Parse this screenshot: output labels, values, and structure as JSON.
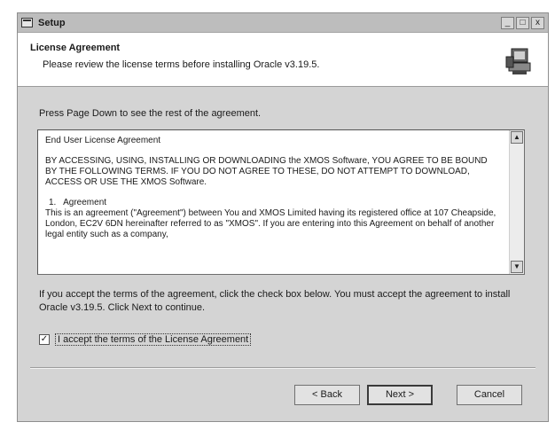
{
  "window": {
    "title": "Setup",
    "controls": {
      "minimize": "_",
      "maximize": "□",
      "close": "x"
    }
  },
  "header": {
    "title": "License Agreement",
    "subtitle": "Please review the license terms before installing Oracle v3.19.5."
  },
  "instructions": "Press Page Down to see the rest of the agreement.",
  "license": {
    "paragraphs": [
      "End User License Agreement",
      "BY ACCESSING, USING, INSTALLING OR DOWNLOADING the XMOS Software, YOU AGREE TO BE BOUND BY THE FOLLOWING TERMS. IF YOU DO NOT AGREE TO THESE, DO NOT ATTEMPT TO DOWNLOAD, ACCESS OR USE THE XMOS Software.",
      "1.   Agreement",
      "This is an agreement (\"Agreement\") between You and XMOS Limited having its registered office at 107 Cheapside, London, EC2V 6DN hereinafter referred to as \"XMOS\". If you are entering into this Agreement on behalf of another legal entity such as a company,"
    ]
  },
  "accept_text": "If you accept the terms of the agreement, click the check box below. You must accept the agreement to install Oracle v3.19.5. Click Next to continue.",
  "agree_checkbox": {
    "label": "I accept the terms of the License Agreement",
    "checked": true,
    "mark": "✓"
  },
  "buttons": {
    "back": "< Back",
    "next": "Next >",
    "cancel": "Cancel"
  },
  "scrollbar": {
    "up": "▲",
    "down": "▼"
  }
}
